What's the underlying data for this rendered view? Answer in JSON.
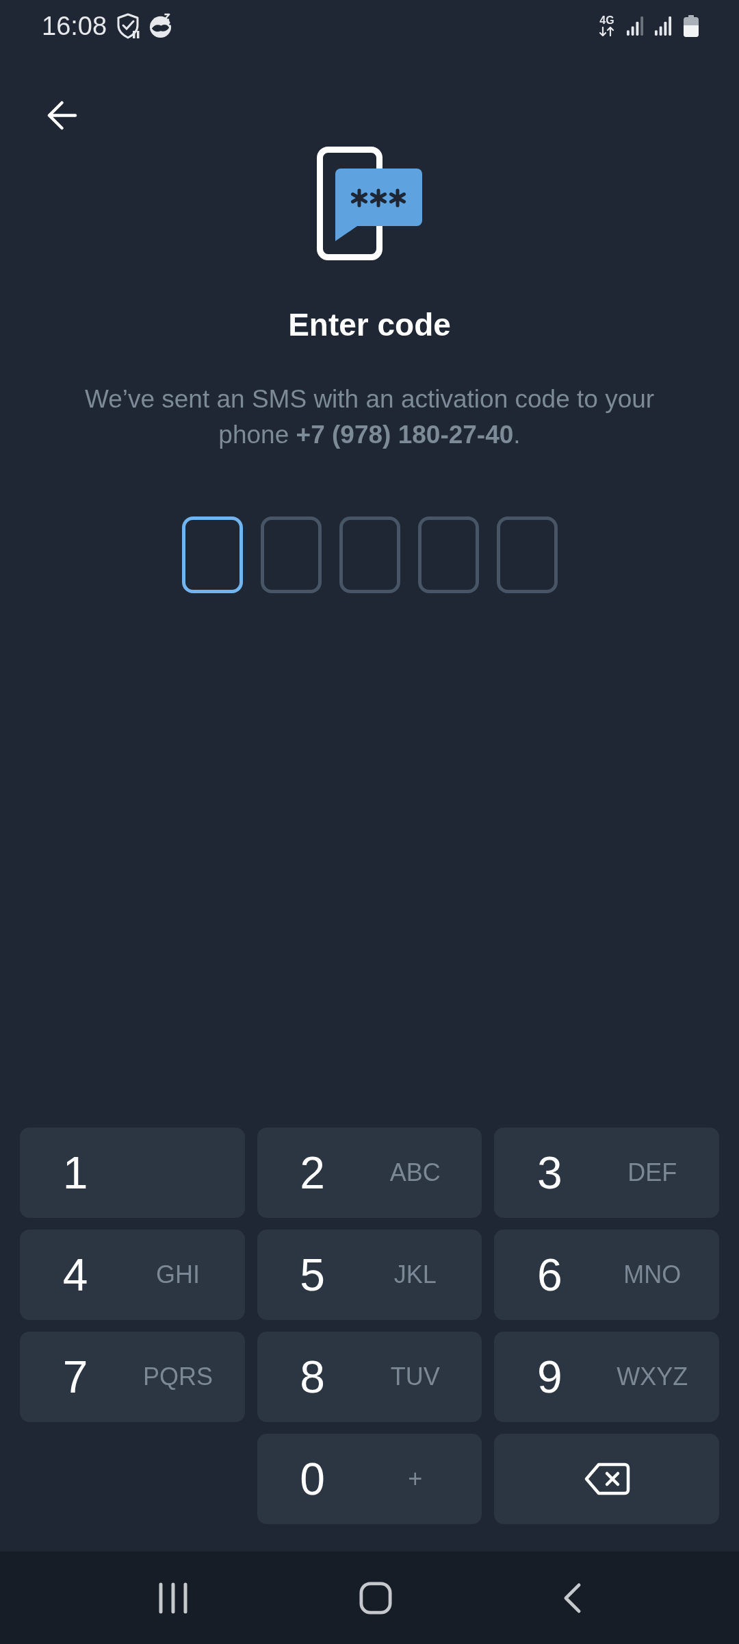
{
  "status_bar": {
    "time": "16:08",
    "network": "4G"
  },
  "header": {
    "title": "Enter code",
    "message": "We’ve sent an SMS with an activation code to your phone **+7 (978) 180-27-40**."
  },
  "code_fields": [
    {
      "selected": true
    },
    {
      "selected": false
    },
    {
      "selected": false
    },
    {
      "selected": false
    },
    {
      "selected": false
    }
  ],
  "keypad": [
    {
      "kind": "digit",
      "digit": "1"
    },
    {
      "kind": "digit",
      "digit": "2",
      "letters": "ABC"
    },
    {
      "kind": "digit",
      "digit": "3",
      "letters": "DEF"
    },
    {
      "kind": "digit",
      "digit": "4",
      "letters": "GHI"
    },
    {
      "kind": "digit",
      "digit": "5",
      "letters": "JKL"
    },
    {
      "kind": "digit",
      "digit": "6",
      "letters": "MNO"
    },
    {
      "kind": "digit",
      "digit": "7",
      "letters": "PQRS"
    },
    {
      "kind": "digit",
      "digit": "8",
      "letters": "TUV"
    },
    {
      "kind": "digit",
      "digit": "9",
      "letters": "WXYZ"
    },
    {
      "kind": "blank"
    },
    {
      "kind": "digit",
      "digit": "0",
      "letters": "+"
    },
    {
      "kind": "backspace"
    }
  ]
}
